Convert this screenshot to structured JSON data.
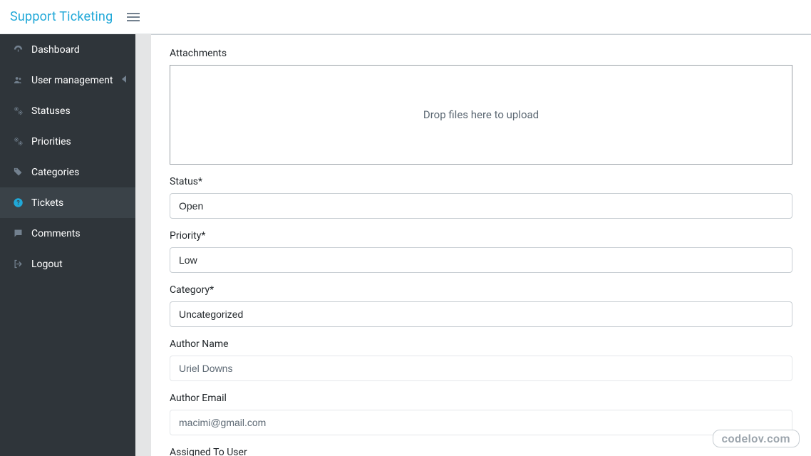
{
  "header": {
    "brand": "Support Ticketing"
  },
  "sidebar": {
    "items": [
      {
        "label": "Dashboard",
        "icon": "dashboard-icon",
        "active": false,
        "hasSubmenu": false
      },
      {
        "label": "User management",
        "icon": "users-icon",
        "active": false,
        "hasSubmenu": true
      },
      {
        "label": "Statuses",
        "icon": "gears-icon",
        "active": false,
        "hasSubmenu": false
      },
      {
        "label": "Priorities",
        "icon": "gears-icon",
        "active": false,
        "hasSubmenu": false
      },
      {
        "label": "Categories",
        "icon": "tags-icon",
        "active": false,
        "hasSubmenu": false
      },
      {
        "label": "Tickets",
        "icon": "question-circle-icon",
        "active": true,
        "hasSubmenu": false
      },
      {
        "label": "Comments",
        "icon": "comment-icon",
        "active": false,
        "hasSubmenu": false
      },
      {
        "label": "Logout",
        "icon": "signout-icon",
        "active": false,
        "hasSubmenu": false
      }
    ]
  },
  "form": {
    "attachments": {
      "label": "Attachments",
      "dropzone_text": "Drop files here to upload"
    },
    "status": {
      "label": "Status*",
      "value": "Open"
    },
    "priority": {
      "label": "Priority*",
      "value": "Low"
    },
    "category": {
      "label": "Category*",
      "value": "Uncategorized"
    },
    "author_name": {
      "label": "Author Name",
      "value": "Uriel Downs"
    },
    "author_email": {
      "label": "Author Email",
      "value": "macimi@gmail.com"
    },
    "assigned_to": {
      "label": "Assigned To User",
      "value": ""
    }
  },
  "watermark": "codelov.com"
}
